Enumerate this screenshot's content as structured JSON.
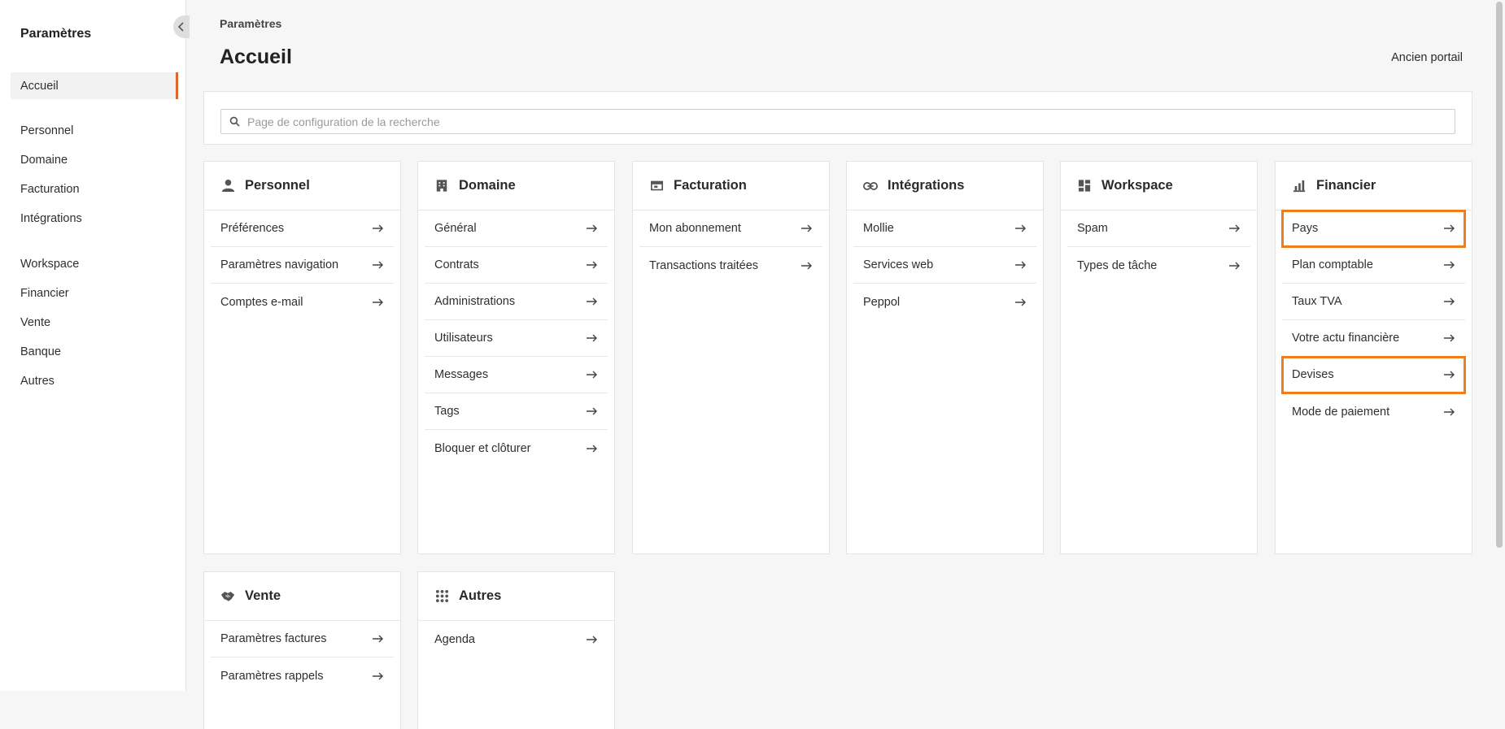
{
  "sidebar": {
    "title": "Paramètres",
    "items": [
      {
        "label": "Accueil"
      },
      {
        "label": "Personnel"
      },
      {
        "label": "Domaine"
      },
      {
        "label": "Facturation"
      },
      {
        "label": "Intégrations"
      },
      {
        "label": "Workspace"
      },
      {
        "label": "Financier"
      },
      {
        "label": "Vente"
      },
      {
        "label": "Banque"
      },
      {
        "label": "Autres"
      }
    ],
    "active": "Accueil"
  },
  "header": {
    "breadcrumb": "Paramètres",
    "title": "Accueil",
    "old_portal": "Ancien portail"
  },
  "search": {
    "placeholder": "Page de configuration de la recherche"
  },
  "cards": [
    {
      "title": "Personnel",
      "icon": "person-icon",
      "items": [
        {
          "label": "Préférences"
        },
        {
          "label": "Paramètres navigation"
        },
        {
          "label": "Comptes e-mail"
        }
      ]
    },
    {
      "title": "Domaine",
      "icon": "building-icon",
      "items": [
        {
          "label": "Général"
        },
        {
          "label": "Contrats"
        },
        {
          "label": "Administrations"
        },
        {
          "label": "Utilisateurs"
        },
        {
          "label": "Messages"
        },
        {
          "label": "Tags"
        },
        {
          "label": "Bloquer et clôturer"
        }
      ]
    },
    {
      "title": "Facturation",
      "icon": "billing-icon",
      "items": [
        {
          "label": "Mon abonnement"
        },
        {
          "label": "Transactions traitées"
        }
      ]
    },
    {
      "title": "Intégrations",
      "icon": "link-icon",
      "items": [
        {
          "label": "Mollie"
        },
        {
          "label": "Services web"
        },
        {
          "label": "Peppol"
        }
      ]
    },
    {
      "title": "Workspace",
      "icon": "dashboard-icon",
      "items": [
        {
          "label": "Spam"
        },
        {
          "label": "Types de tâche"
        }
      ]
    },
    {
      "title": "Financier",
      "icon": "bar-chart-icon",
      "items": [
        {
          "label": "Pays",
          "highlighted": true
        },
        {
          "label": "Plan comptable"
        },
        {
          "label": "Taux TVA"
        },
        {
          "label": "Votre actu financière"
        },
        {
          "label": "Devises",
          "highlighted": true
        },
        {
          "label": "Mode de paiement"
        }
      ]
    },
    {
      "title": "Vente",
      "icon": "handshake-icon",
      "items": [
        {
          "label": "Paramètres factures"
        },
        {
          "label": "Paramètres rappels"
        }
      ]
    },
    {
      "title": "Autres",
      "icon": "grid-dots-icon",
      "items": [
        {
          "label": "Agenda"
        }
      ]
    }
  ],
  "colors": {
    "accent": "#e0652a",
    "highlight": "#f07d18",
    "background": "#f6f6f6"
  }
}
